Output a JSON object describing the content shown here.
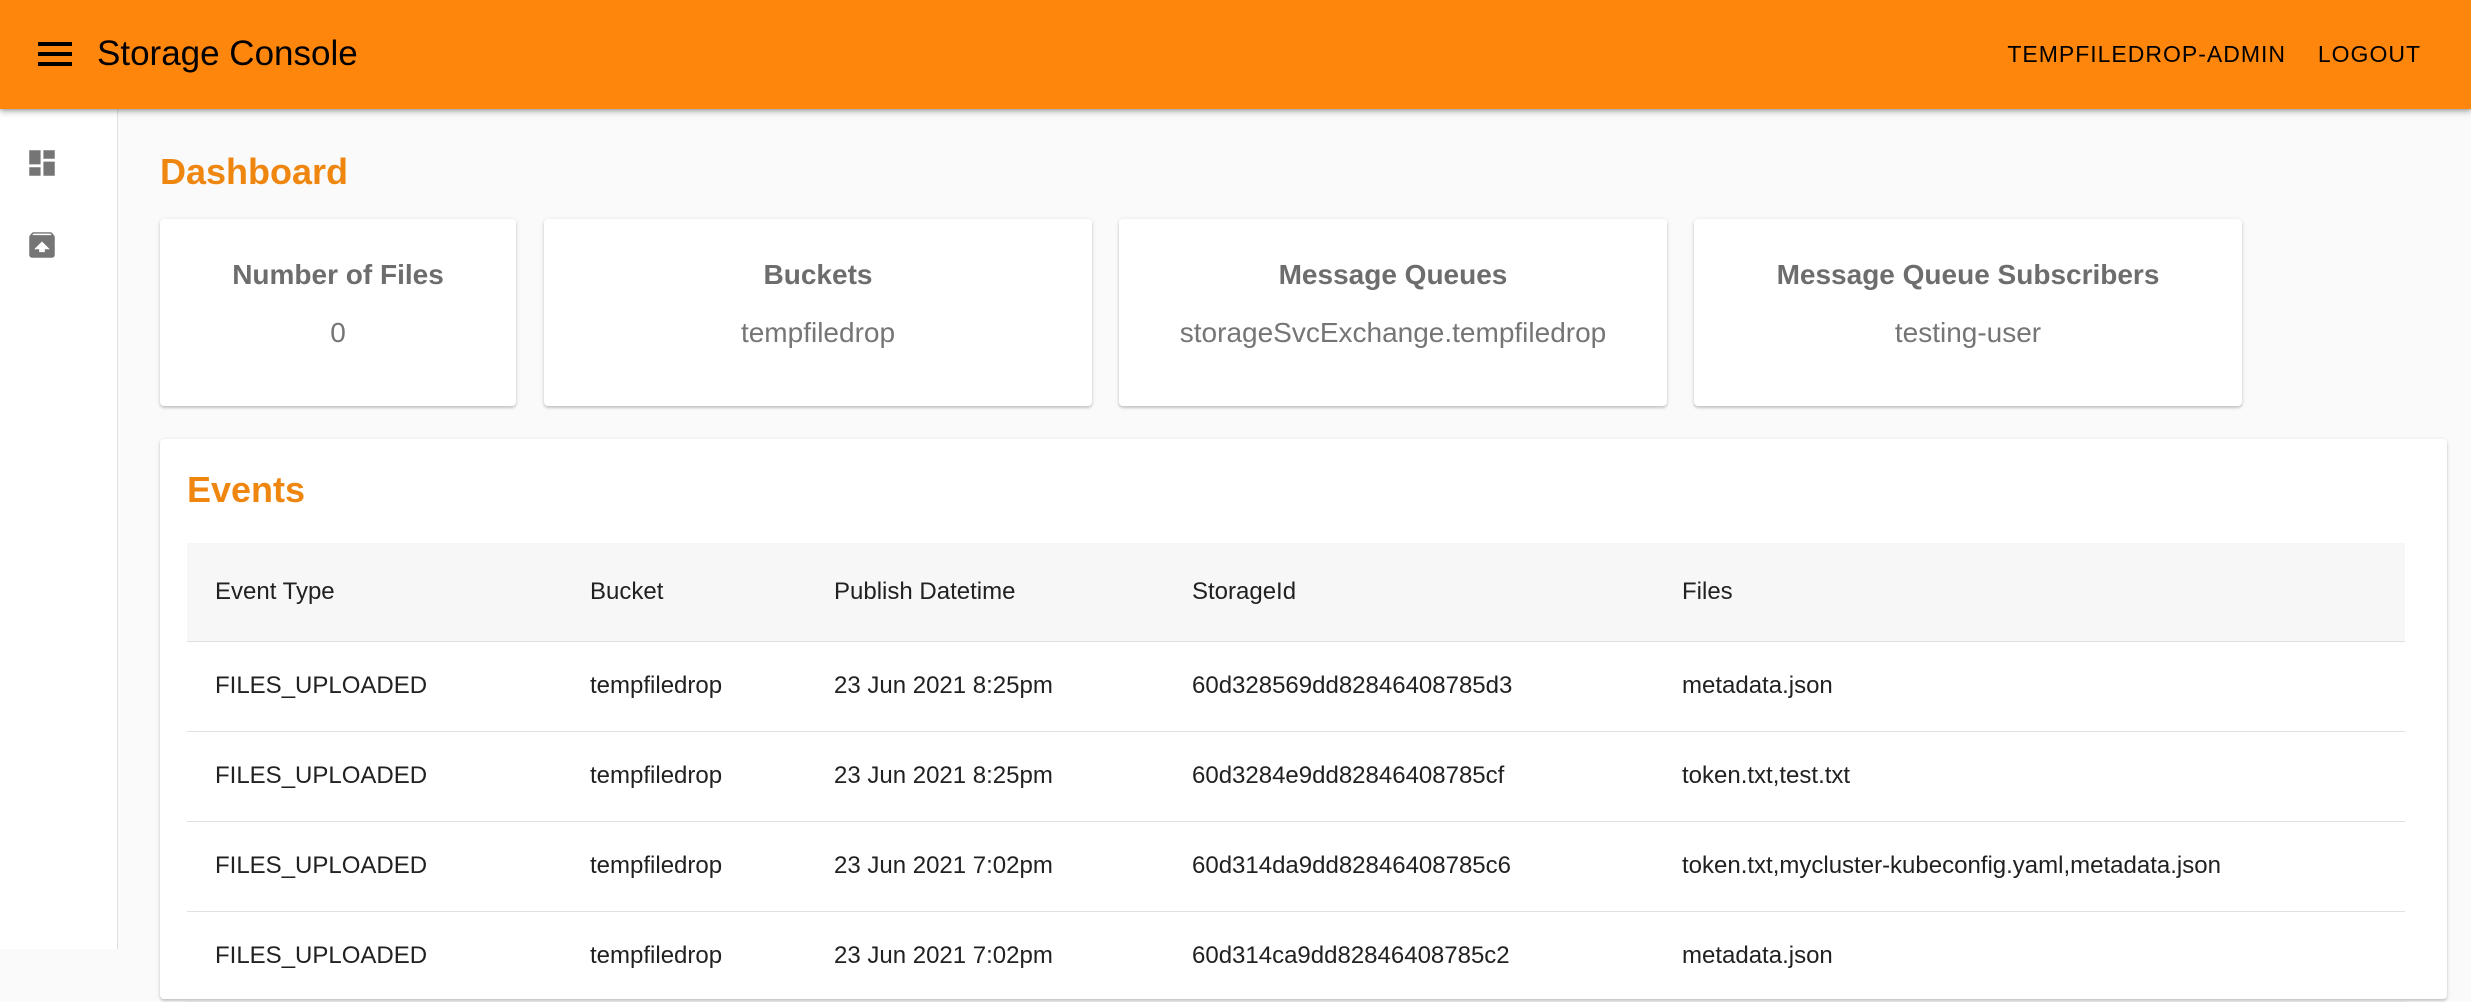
{
  "appbar": {
    "title": "Storage Console",
    "user_label": "TEMPFILEDROP-ADMIN",
    "logout_label": "LOGOUT",
    "menu_icon": "menu-icon",
    "color": "#ff860d"
  },
  "sidebar": {
    "items": [
      {
        "icon": "dashboard-icon"
      },
      {
        "icon": "archive-upload-icon"
      }
    ]
  },
  "dashboard": {
    "title": "Dashboard",
    "cards": [
      {
        "title": "Number of Files",
        "value": "0"
      },
      {
        "title": "Buckets",
        "value": "tempfiledrop"
      },
      {
        "title": "Message Queues",
        "value": "storageSvcExchange.tempfiledrop"
      },
      {
        "title": "Message Queue Subscribers",
        "value": "testing-user"
      }
    ]
  },
  "events": {
    "title": "Events",
    "columns": [
      "Event Type",
      "Bucket",
      "Publish Datetime",
      "StorageId",
      "Files"
    ],
    "rows": [
      [
        "FILES_UPLOADED",
        "tempfiledrop",
        "23 Jun 2021 8:25pm",
        "60d328569dd82846408785d3",
        "metadata.json"
      ],
      [
        "FILES_UPLOADED",
        "tempfiledrop",
        "23 Jun 2021 8:25pm",
        "60d3284e9dd82846408785cf",
        "token.txt,test.txt"
      ],
      [
        "FILES_UPLOADED",
        "tempfiledrop",
        "23 Jun 2021 7:02pm",
        "60d314da9dd82846408785c6",
        "token.txt,mycluster-kubeconfig.yaml,metadata.json"
      ],
      [
        "FILES_UPLOADED",
        "tempfiledrop",
        "23 Jun 2021 7:02pm",
        "60d314ca9dd82846408785c2",
        "metadata.json"
      ]
    ]
  },
  "colors": {
    "accent": "#ef860f",
    "appbar": "#ff860d"
  }
}
